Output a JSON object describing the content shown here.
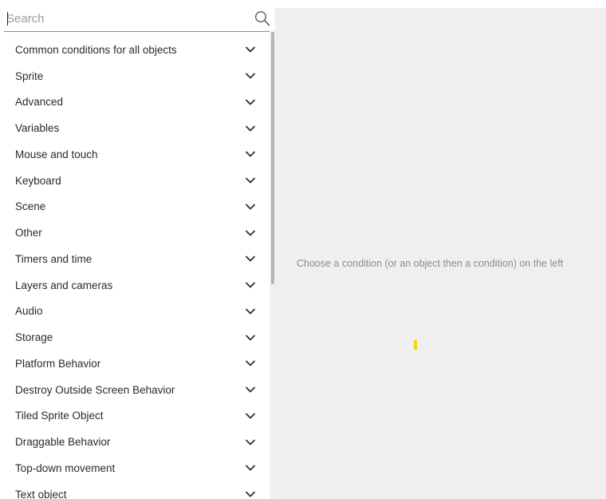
{
  "search": {
    "placeholder": "Search",
    "value": ""
  },
  "categories": [
    {
      "label": "Common conditions for all objects",
      "icon": "chevron-down-icon"
    },
    {
      "label": "Sprite",
      "icon": "chevron-down-icon"
    },
    {
      "label": "Advanced",
      "icon": "chevron-down-icon"
    },
    {
      "label": "Variables",
      "icon": "chevron-down-icon"
    },
    {
      "label": "Mouse and touch",
      "icon": "chevron-down-icon"
    },
    {
      "label": "Keyboard",
      "icon": "chevron-down-icon"
    },
    {
      "label": "Scene",
      "icon": "chevron-down-icon"
    },
    {
      "label": "Other",
      "icon": "chevron-down-icon"
    },
    {
      "label": "Timers and time",
      "icon": "chevron-down-icon"
    },
    {
      "label": "Layers and cameras",
      "icon": "chevron-down-icon"
    },
    {
      "label": "Audio",
      "icon": "chevron-down-icon"
    },
    {
      "label": "Storage",
      "icon": "chevron-down-icon"
    },
    {
      "label": "Platform Behavior",
      "icon": "chevron-down-icon"
    },
    {
      "label": "Destroy Outside Screen Behavior",
      "icon": "chevron-down-icon"
    },
    {
      "label": "Tiled Sprite Object",
      "icon": "chevron-down-icon"
    },
    {
      "label": "Draggable Behavior",
      "icon": "chevron-down-icon"
    },
    {
      "label": "Top-down movement",
      "icon": "chevron-down-icon"
    },
    {
      "label": "Text object",
      "icon": "chevron-down-icon"
    }
  ],
  "main": {
    "empty_message": "Choose a condition (or an object then a condition) on the left"
  },
  "colors": {
    "panel_background": "#efefef",
    "text": "#2b2b2b",
    "muted_text": "#8c8c8c",
    "highlight": "#f2d700"
  }
}
